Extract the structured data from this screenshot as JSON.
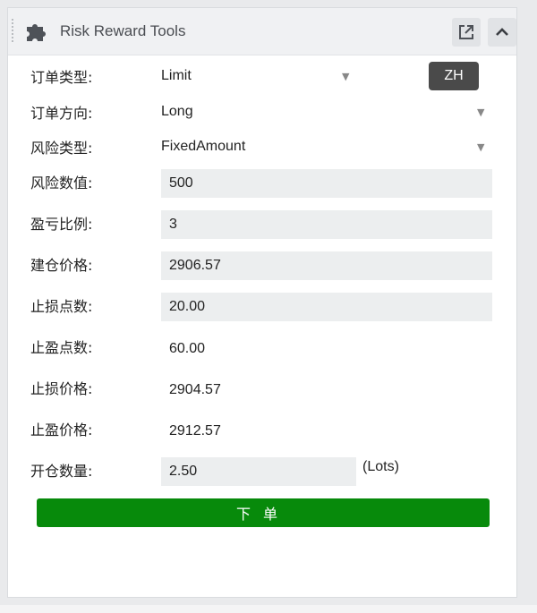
{
  "header": {
    "title": "Risk Reward Tools",
    "icons": {
      "left": "puzzle-icon",
      "popout": "external-link-icon",
      "collapse": "chevron-up-icon"
    }
  },
  "lang_button": "ZH",
  "fields": {
    "order_type": {
      "label": "订单类型:",
      "value": "Limit"
    },
    "order_direction": {
      "label": "订单方向:",
      "value": "Long"
    },
    "risk_type": {
      "label": "风险类型:",
      "value": "FixedAmount"
    },
    "risk_value": {
      "label": "风险数值:",
      "value": "500"
    },
    "rr_ratio": {
      "label": "盈亏比例:",
      "value": "3"
    },
    "entry_price": {
      "label": "建仓价格:",
      "value": "2906.57"
    },
    "stop_points": {
      "label": "止损点数:",
      "value": "20.00"
    },
    "tp_points": {
      "label": "止盈点数:",
      "value": "60.00"
    },
    "stop_price": {
      "label": "止损价格:",
      "value": "2904.57"
    },
    "tp_price": {
      "label": "止盈价格:",
      "value": "2912.57"
    },
    "position_size": {
      "label": "开仓数量:",
      "value": "2.50",
      "unit": "(Lots)"
    }
  },
  "submit_label": "下单",
  "colors": {
    "submit_bg": "#078a0b",
    "zh_bg": "#4a4a4a",
    "field_bg": "#eceeef"
  }
}
